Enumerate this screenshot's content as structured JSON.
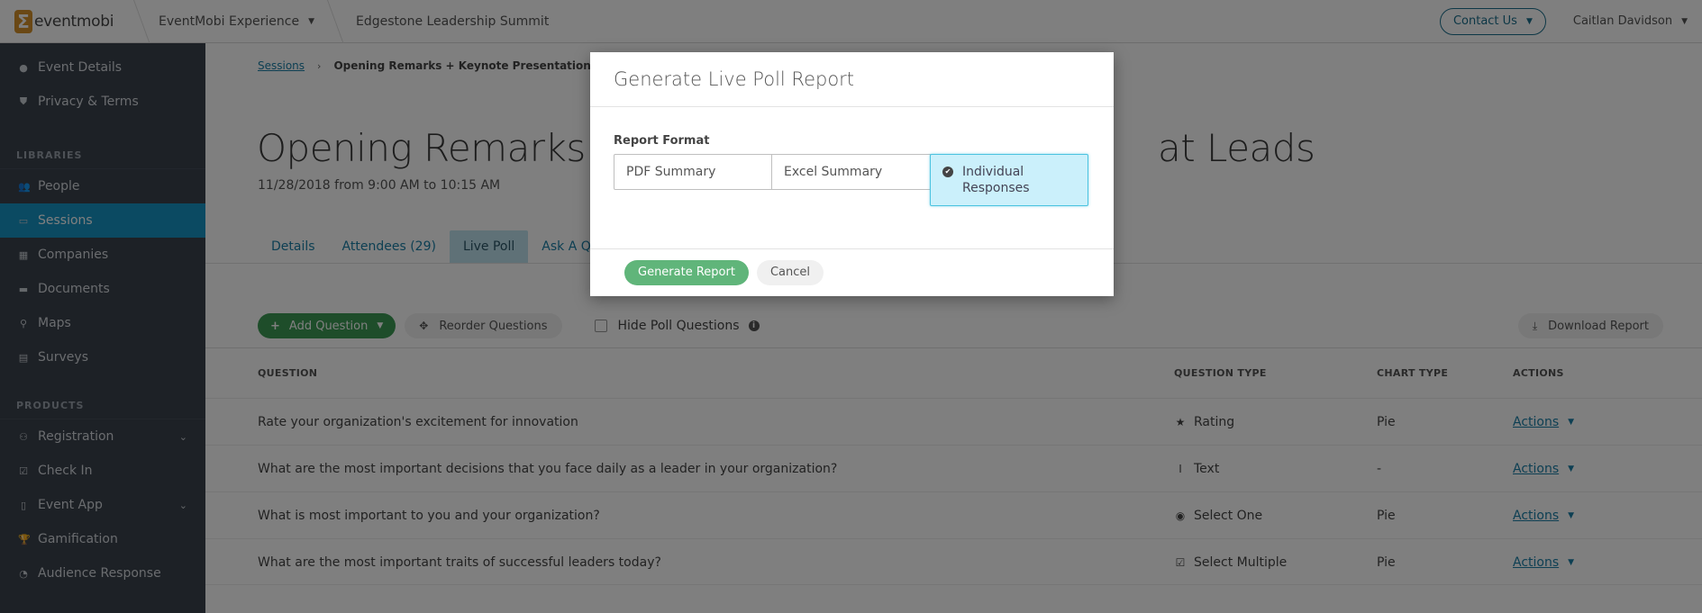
{
  "topbar": {
    "logo_text": "eventmobi",
    "event_picker": "EventMobi Experience",
    "event_name": "Edgestone Leadership Summit",
    "contact_label": "Contact Us",
    "user_name": "Caitlan Davidson"
  },
  "sidebar": {
    "top_items": [
      {
        "label": "Event Details",
        "icon": "info-circle-icon"
      },
      {
        "label": "Privacy & Terms",
        "icon": "shield-icon"
      }
    ],
    "libraries_heading": "LIBRARIES",
    "libraries": [
      {
        "label": "People",
        "icon": "users-icon"
      },
      {
        "label": "Sessions",
        "icon": "calendar-icon",
        "active": true
      },
      {
        "label": "Companies",
        "icon": "building-icon"
      },
      {
        "label": "Documents",
        "icon": "briefcase-icon"
      },
      {
        "label": "Maps",
        "icon": "map-marker-icon"
      },
      {
        "label": "Surveys",
        "icon": "clipboard-icon"
      }
    ],
    "products_heading": "PRODUCTS",
    "products": [
      {
        "label": "Registration",
        "icon": "user-plus-icon",
        "expandable": true
      },
      {
        "label": "Check In",
        "icon": "check-square-icon"
      },
      {
        "label": "Event App",
        "icon": "tablet-icon",
        "expandable": true
      },
      {
        "label": "Gamification",
        "icon": "trophy-icon"
      },
      {
        "label": "Audience Response",
        "icon": "pie-chart-icon"
      }
    ]
  },
  "main": {
    "breadcrumb": {
      "parent": "Sessions",
      "current": "Opening Remarks + Keynote Presentation: A Vision"
    },
    "title_visible_start": "Opening Remarks + K",
    "title_visible_end": "at Leads",
    "date": "11/28/2018 from 9:00 AM to 10:15 AM",
    "tabs": [
      {
        "label": "Details"
      },
      {
        "label": "Attendees (29)"
      },
      {
        "label": "Live Poll",
        "active": true
      },
      {
        "label": "Ask A Que"
      }
    ],
    "toolbar": {
      "add_question": "Add Question",
      "reorder": "Reorder Questions",
      "hide_poll": "Hide Poll Questions",
      "hide_poll_checked": false,
      "download": "Download Report"
    },
    "table": {
      "headers": {
        "question": "QUESTION",
        "question_type": "QUESTION TYPE",
        "chart_type": "CHART TYPE",
        "actions": "ACTIONS"
      },
      "rows": [
        {
          "question": "Rate your organization's excitement for innovation",
          "type": "Rating",
          "type_icon": "star-icon",
          "chart": "Pie",
          "action": "Actions"
        },
        {
          "question": "What are the most important decisions that you face daily as a leader in your organization?",
          "type": "Text",
          "type_icon": "text-cursor-icon",
          "chart": "-",
          "action": "Actions"
        },
        {
          "question": "What is most important to you and your organization?",
          "type": "Select One",
          "type_icon": "radio-icon",
          "chart": "Pie",
          "action": "Actions"
        },
        {
          "question": "What are the most important traits of successful leaders today?",
          "type": "Select Multiple",
          "type_icon": "checkbox-icon",
          "chart": "Pie",
          "action": "Actions"
        }
      ]
    }
  },
  "modal": {
    "title": "Generate Live Poll Report",
    "field_label": "Report Format",
    "options": [
      {
        "label": "PDF Summary",
        "selected": false
      },
      {
        "label": "Excel Summary",
        "selected": false
      },
      {
        "label": "Individual Responses",
        "selected": true
      }
    ],
    "generate_label": "Generate Report",
    "cancel_label": "Cancel"
  }
}
